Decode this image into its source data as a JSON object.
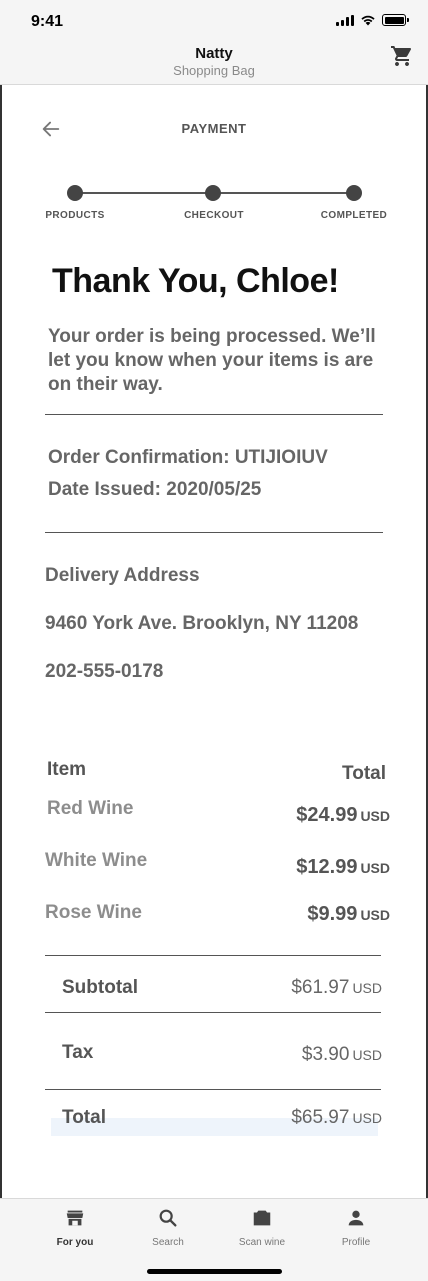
{
  "status": {
    "time": "9:41"
  },
  "header": {
    "title": "Natty",
    "subtitle": "Shopping Bag",
    "icons": [
      "cart-icon"
    ]
  },
  "page": {
    "title": "PAYMENT",
    "back_icon": "arrow-left-icon"
  },
  "steps": [
    "PRODUCTS",
    "CHECKOUT",
    "COMPLETED"
  ],
  "confirmation": {
    "heading": "Thank You, Chloe!",
    "message": "Your order is being processed. We’ll let you know when your items is are on their way.",
    "order_line": "Order Confirmation: UTIJIOIUV",
    "date_line": "Date Issued: 2020/05/25"
  },
  "delivery": {
    "label": "Delivery Address",
    "address": "9460 York Ave. Brooklyn, NY 11208",
    "phone": "202-555-0178"
  },
  "order": {
    "item_header": "Item",
    "total_header": "Total",
    "items": [
      {
        "name": "Red Wine",
        "price": "$24.99",
        "currency": "USD"
      },
      {
        "name": "White Wine",
        "price": "$12.99",
        "currency": "USD"
      },
      {
        "name": "Rose Wine",
        "price": "$9.99",
        "currency": "USD"
      }
    ],
    "subtotal": {
      "label": "Subtotal",
      "value": "$61.97",
      "currency": "USD"
    },
    "tax": {
      "label": "Tax",
      "value": "$3.90",
      "currency": "USD"
    },
    "total": {
      "label": "Total",
      "value": "$65.97",
      "currency": "USD"
    }
  },
  "tabs": [
    {
      "label": "For you",
      "icon": "store-icon",
      "active": true
    },
    {
      "label": "Search",
      "icon": "search-icon",
      "active": false
    },
    {
      "label": "Scan wine",
      "icon": "camera-icon",
      "active": false
    },
    {
      "label": "Profile",
      "icon": "person-icon",
      "active": false
    }
  ],
  "colors": {
    "text_dark": "#111111",
    "text_muted": "#666666",
    "bar_bg": "#f5f5f5"
  }
}
